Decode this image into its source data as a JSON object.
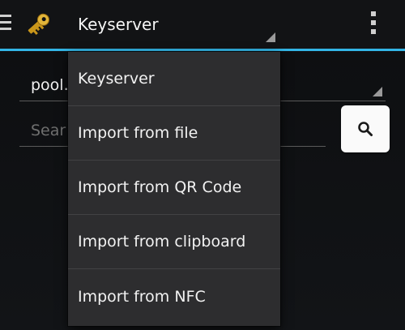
{
  "action_bar": {
    "spinner_title": "Keyserver",
    "accent_color": "#33b5e5",
    "icons": {
      "drawer": "hamburger-menu-icon",
      "app": "key-icon",
      "overflow": "overflow-menu-icon"
    }
  },
  "form": {
    "keyserver_value": "pool.",
    "search_placeholder": "Sear",
    "search_icon": "search-icon"
  },
  "dropdown": {
    "items": [
      {
        "label": "Keyserver"
      },
      {
        "label": "Import from file"
      },
      {
        "label": "Import from QR Code"
      },
      {
        "label": "Import from clipboard"
      },
      {
        "label": "Import from NFC"
      }
    ]
  }
}
